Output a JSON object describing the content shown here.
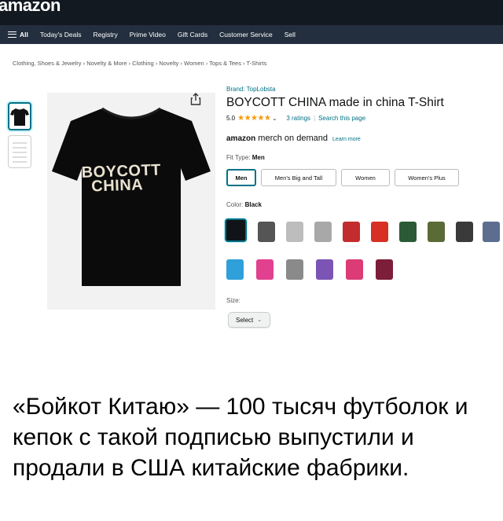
{
  "header": {
    "logo": "amazon"
  },
  "nav": {
    "items": [
      "All",
      "Today's Deals",
      "Registry",
      "Prime Video",
      "Gift Cards",
      "Customer Service",
      "Sell"
    ]
  },
  "breadcrumb": "Clothing, Shoes & Jewelry › Novelty & More › Clothing › Novelty › Women › Tops & Tees › T-Shirts",
  "product": {
    "print_line1": "BOYCOTT",
    "print_line2": "CHINA",
    "brand": "Brand: TopLobsta",
    "title": "BOYCOTT CHINA made in china T-Shirt",
    "rating_value": "5.0",
    "stars": "★★★★★",
    "ratings_link": "3 ratings",
    "search_link": "Search this page",
    "merch_amazon": "amazon",
    "merch_text": "merch on demand",
    "learn_more": "Learn more",
    "fit_label": "Fit Type:",
    "fit_value": "Men",
    "fit_options": [
      "Men",
      "Men's Big and Tall",
      "Women",
      "Women's Plus"
    ],
    "color_label": "Color:",
    "color_value": "Black",
    "colors_row1": [
      "#101418",
      "#555555",
      "#bdbdbd",
      "#a8a8a8",
      "#c32c2c",
      "#d72f23",
      "#2b5b36",
      "#5a6b36",
      "#3a3a3a",
      "#5d6d8f"
    ],
    "colors_row2": [
      "#2fa0d9",
      "#e2418f",
      "#8a8a8a",
      "#7b54b5",
      "#dd3b75",
      "#7c1d3a"
    ],
    "size_label": "Size:",
    "size_value": "Select"
  },
  "caption": "«Бойкот Китаю» — 100 тысяч футболок и кепок с такой подписью выпустили и продали в США китайские фабрики."
}
